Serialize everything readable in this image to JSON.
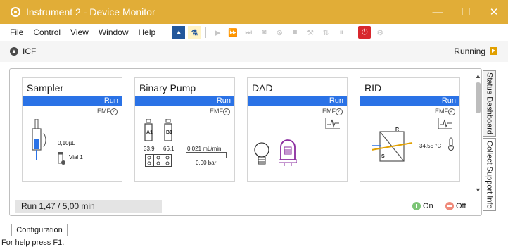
{
  "window": {
    "title": "Instrument 2 - Device Monitor",
    "controls": {
      "minimize": "—",
      "maximize": "☐",
      "close": "✕"
    }
  },
  "menu": {
    "items": [
      "File",
      "Control",
      "View",
      "Window",
      "Help"
    ]
  },
  "status": {
    "group": "ICF",
    "state": "Running"
  },
  "modules": [
    {
      "title": "Sampler",
      "status": "Run",
      "emf": "EMF",
      "volume": "0,10µL",
      "vial": "Vial 1"
    },
    {
      "title": "Binary Pump",
      "status": "Run",
      "emf": "EMF",
      "bottle_a": "A1",
      "bottle_b": "B1",
      "percent_a": "33,9",
      "percent_b": "66,1",
      "flow": "0,021 mL/min",
      "pressure": "0,00 bar"
    },
    {
      "title": "DAD",
      "status": "Run",
      "emf": "EMF"
    },
    {
      "title": "RID",
      "status": "Run",
      "emf": "EMF",
      "temperature": "34,55 °C",
      "cell_r": "R",
      "cell_s": "S"
    }
  ],
  "progress": {
    "text": "Run 1,47 / 5,00 min",
    "fraction": 0.294
  },
  "legend": {
    "on": "On",
    "off": "Off"
  },
  "side_tabs": [
    "Status Dashboard",
    "Collect Support Info"
  ],
  "footer": {
    "configuration": "Configuration",
    "help": "For help press F1."
  },
  "colors": {
    "titlebar": "#e1ad37",
    "run_bar": "#2a72e6",
    "running_icon": "#e1a000",
    "stop_button": "#d8272d"
  }
}
